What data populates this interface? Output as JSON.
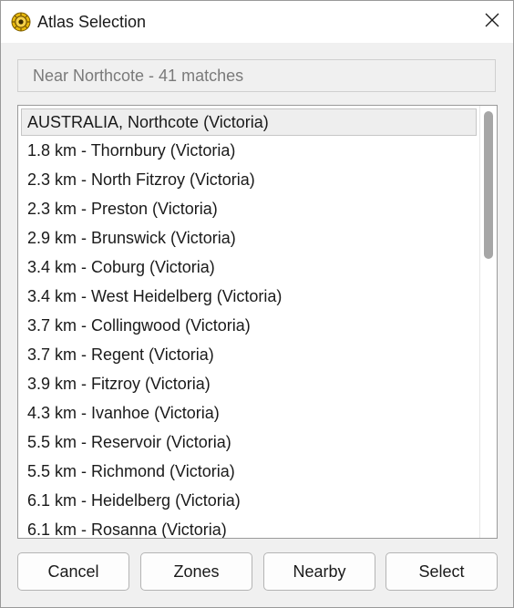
{
  "window": {
    "title": "Atlas Selection",
    "icon": "atlas-app-icon",
    "close_icon": "close-icon"
  },
  "header": {
    "text": "Near Northcote - 41 matches"
  },
  "list": {
    "items": [
      "AUSTRALIA, Northcote (Victoria)",
      "1.8 km - Thornbury (Victoria)",
      "2.3 km - North Fitzroy (Victoria)",
      "2.3 km - Preston (Victoria)",
      "2.9 km - Brunswick (Victoria)",
      "3.4 km - Coburg (Victoria)",
      "3.4 km - West Heidelberg (Victoria)",
      "3.7 km - Collingwood (Victoria)",
      "3.7 km - Regent (Victoria)",
      "3.9 km - Fitzroy (Victoria)",
      "4.3 km - Ivanhoe (Victoria)",
      "5.5 km - Reservoir (Victoria)",
      "5.5 km - Richmond (Victoria)",
      "6.1 km - Heidelberg (Victoria)",
      "6.1 km - Rosanna (Victoria)"
    ],
    "selected_index": 0
  },
  "buttons": {
    "cancel": "Cancel",
    "zones": "Zones",
    "nearby": "Nearby",
    "select": "Select"
  },
  "colors": {
    "accent_icon": "#e8b90c",
    "selection_bg": "#eeeeee",
    "header_text": "#7a7a7a"
  }
}
